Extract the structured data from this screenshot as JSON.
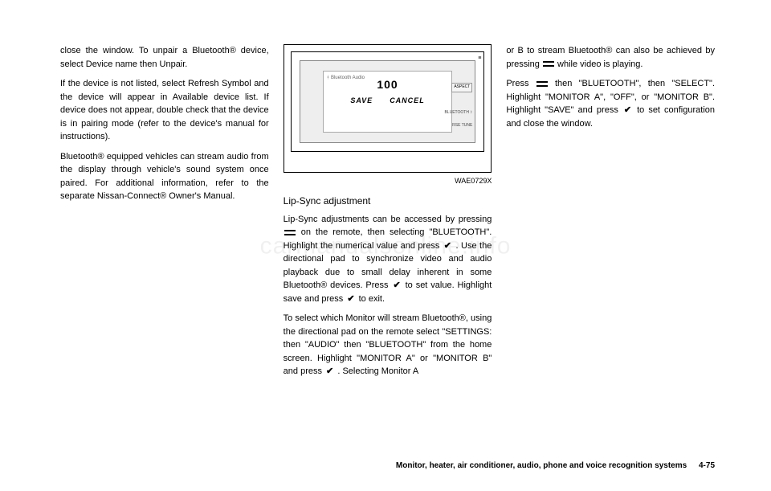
{
  "col1": {
    "p1": "close the window. To unpair a Bluetooth® device, select Device name then Unpair.",
    "p2": "If the device is not listed, select Refresh Symbol and the device will appear in Available device list. If device does not appear, double check that the device is in pairing mode (refer to the device's manual for instructions).",
    "p3": "Bluetooth® equipped vehicles can stream audio from the display through vehicle's sound system once paired. For additional information, refer to the separate Nissan-Connect® Owner's Manual."
  },
  "figure": {
    "bt_audio": "Bluetooth Audio",
    "line1": "",
    "line2": "",
    "value": "100",
    "save": "SAVE",
    "cancel": "CANCEL",
    "aspect": "ASPECT",
    "bluetooth": "BLUETOOTH",
    "tune": "RSE TUNE",
    "code": "WAE0729X"
  },
  "col2": {
    "heading": "Lip-Sync adjustment",
    "p1a": "Lip-Sync adjustments can be accessed by pressing ",
    "p1b": " on the remote, then selecting \"BLUETOOTH\". Highlight the numerical value and press ",
    "p1c": ". Use the directional pad to synchronize video and audio playback due to small delay inherent in some Bluetooth® devices. Press ",
    "p1d": " to set value. Highlight save and press ",
    "p1e": " to exit.",
    "p2a": "To select which Monitor will stream Bluetooth®, using the directional pad on the remote select \"SETTINGS: then \"AUDIO\" then \"BLUETOOTH\" from the home screen. Highlight \"MONITOR A\" or \"MONITOR B\" and press ",
    "p2b": ". Selecting Monitor A"
  },
  "col3": {
    "p1a": "or B to stream Bluetooth® can also be achieved by pressing ",
    "p1b": " while video is playing.",
    "p2a": "Press ",
    "p2b": " then \"BLUETOOTH\", then \"SELECT\". Highlight \"MONITOR A\", \"OFF\", or \"MONITOR B\". Highlight \"SAVE\" and press ",
    "p2c": " to set configuration and close the window."
  },
  "footer": {
    "section": "Monitor, heater, air conditioner, audio, phone and voice recognition systems",
    "page": "4-75"
  },
  "watermark": "carmanualsonline.info",
  "check": "✔"
}
